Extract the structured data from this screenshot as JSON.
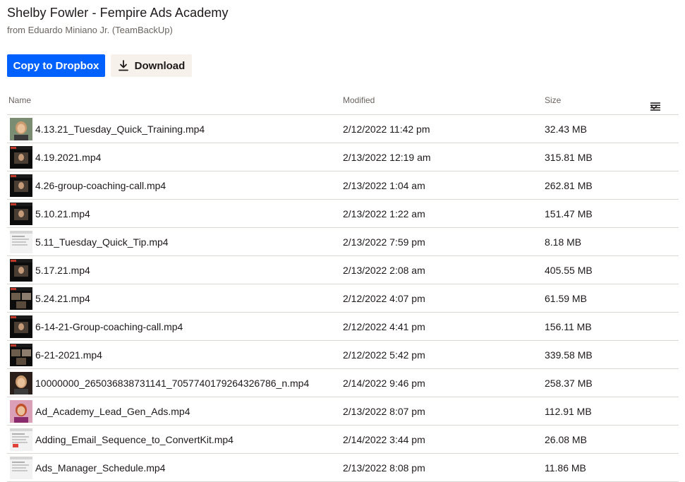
{
  "header": {
    "title": "Shelby Fowler - Fempire Ads Academy",
    "subtitle": "from Eduardo Miniano Jr. (TeamBackUp)"
  },
  "actions": {
    "copy_label": "Copy to Dropbox",
    "download_label": "Download"
  },
  "table": {
    "columns": {
      "name": "Name",
      "modified": "Modified",
      "size": "Size"
    },
    "rows": [
      {
        "name": "4.13.21_Tuesday_Quick_Training.mp4",
        "modified": "2/12/2022 11:42 pm",
        "size": "32.43 MB",
        "thumb": "person"
      },
      {
        "name": "4.19.2021.mp4",
        "modified": "2/13/2022 12:19 am",
        "size": "315.81 MB",
        "thumb": "dark-video"
      },
      {
        "name": "4.26-group-coaching-call.mp4",
        "modified": "2/13/2022 1:04 am",
        "size": "262.81 MB",
        "thumb": "dark-video"
      },
      {
        "name": "5.10.21.mp4",
        "modified": "2/13/2022 1:22 am",
        "size": "151.47 MB",
        "thumb": "dark-video"
      },
      {
        "name": "5.11_Tuesday_Quick_Tip.mp4",
        "modified": "2/13/2022 7:59 pm",
        "size": "8.18 MB",
        "thumb": "screen"
      },
      {
        "name": "5.17.21.mp4",
        "modified": "2/13/2022 2:08 am",
        "size": "405.55 MB",
        "thumb": "dark-video"
      },
      {
        "name": "5.24.21.mp4",
        "modified": "2/12/2022 4:07 pm",
        "size": "61.59 MB",
        "thumb": "grid-video"
      },
      {
        "name": "6-14-21-Group-coaching-call.mp4",
        "modified": "2/12/2022 4:41 pm",
        "size": "156.11 MB",
        "thumb": "dark-video"
      },
      {
        "name": "6-21-2021.mp4",
        "modified": "2/12/2022 5:42 pm",
        "size": "339.58 MB",
        "thumb": "grid-video"
      },
      {
        "name": "10000000_265036838731141_7057740179264326786_n.mp4",
        "modified": "2/14/2022 9:46 pm",
        "size": "258.37 MB",
        "thumb": "person-dark"
      },
      {
        "name": "Ad_Academy_Lead_Gen_Ads.mp4",
        "modified": "2/13/2022 8:07 pm",
        "size": "112.91 MB",
        "thumb": "person-pink"
      },
      {
        "name": "Adding_Email_Sequence_to_ConvertKit.mp4",
        "modified": "2/14/2022 3:44 pm",
        "size": "26.08 MB",
        "thumb": "screen-red"
      },
      {
        "name": "Ads_Manager_Schedule.mp4",
        "modified": "2/13/2022 8:08 pm",
        "size": "11.86 MB",
        "thumb": "screen"
      }
    ]
  },
  "colors": {
    "primary": "#0061fe",
    "secondary_bg": "#f7f1eb",
    "divider": "#dcd7d2",
    "muted_text": "#6b6460"
  },
  "icons": {
    "download": "download-icon",
    "view_toggle": "list-view-icon",
    "chevron": "chevron-down-icon"
  }
}
